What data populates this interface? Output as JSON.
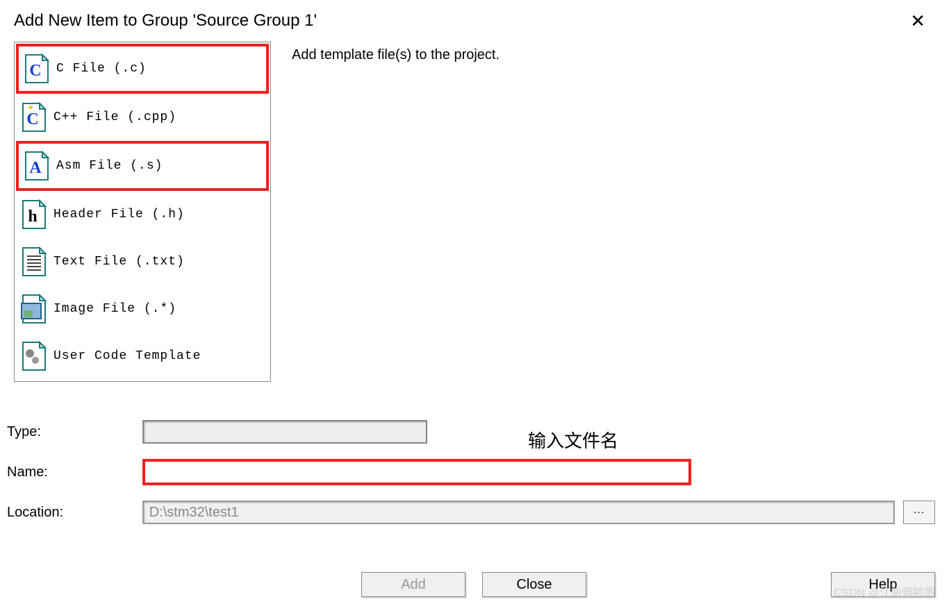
{
  "title": "Add New Item to Group 'Source Group 1'",
  "description": "Add template file(s) to the project.",
  "file_types": [
    {
      "label": "C File (.c)",
      "icon_letter": "C",
      "icon_color": "#1040d0",
      "highlighted": true
    },
    {
      "label": "C++ File (.cpp)",
      "icon_letter": "C",
      "icon_color": "#1040d0",
      "highlighted": false,
      "icon_accent": "star"
    },
    {
      "label": "Asm File (.s)",
      "icon_letter": "A",
      "icon_color": "#1040d0",
      "highlighted": true
    },
    {
      "label": "Header File (.h)",
      "icon_letter": "h",
      "icon_color": "#000000",
      "highlighted": false
    },
    {
      "label": "Text File (.txt)",
      "icon_letter": "lines",
      "icon_color": "#444",
      "highlighted": false
    },
    {
      "label": "Image File (.*)",
      "icon_letter": "img",
      "icon_color": "#447",
      "highlighted": false
    },
    {
      "label": "User Code Template",
      "icon_letter": "gear",
      "icon_color": "#555",
      "highlighted": false
    }
  ],
  "form": {
    "type_label": "Type:",
    "type_value": "",
    "name_label": "Name:",
    "name_value": "",
    "location_label": "Location:",
    "location_value": "D:\\stm32\\test1",
    "browse_label": "..."
  },
  "annotation": "输入文件名",
  "buttons": {
    "add": "Add",
    "close": "Close",
    "help": "Help"
  },
  "watermark": "CSDN @江南烟脓雨"
}
